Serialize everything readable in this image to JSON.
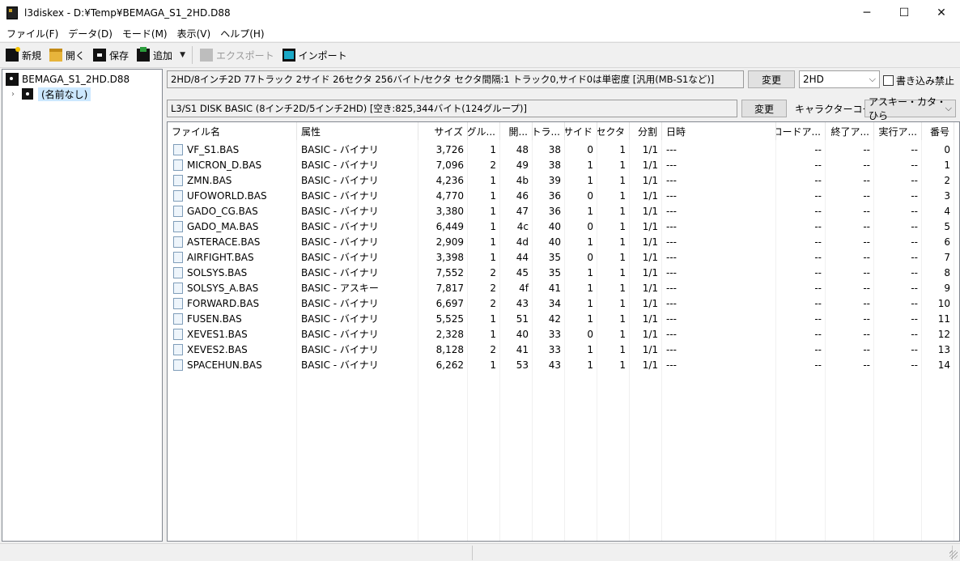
{
  "window": {
    "title": "l3diskex - D:¥Temp¥BEMAGA_S1_2HD.D88",
    "controls": {
      "minimize": "─",
      "maximize": "☐",
      "close": "✕"
    }
  },
  "menu": [
    "ファイル(F)",
    "データ(D)",
    "モード(M)",
    "表示(V)",
    "ヘルプ(H)"
  ],
  "toolbar": {
    "new": "新規",
    "open": "開く",
    "save": "保存",
    "add": "追加",
    "add_dropdown": "▼",
    "export": "エクスポート",
    "import": "インポート"
  },
  "tree": {
    "root": "BEMAGA_S1_2HD.D88",
    "child_expander": "›",
    "child": "(名前なし)"
  },
  "disk_info": {
    "format": "2HD/8インチ2D  77トラック 2サイド 26セクタ 256バイト/セクタ セクタ間隔:1 トラック0,サイド0は単密度 [汎用(MB-S1など)]",
    "change_button": "変更",
    "type_select": "2HD",
    "write_protect_label": "書き込み禁止",
    "basic_info": "L3/S1 DISK BASIC (8インチ2D/5インチ2HD) [空き:825,344バイト(124グループ)]",
    "basic_change_button": "変更",
    "charcode_label": "キャラクターコード",
    "charcode_select": "アスキー・カタ・ひら"
  },
  "columns": [
    "ファイル名",
    "属性",
    "サイズ",
    "グル...",
    "開...",
    "トラ...",
    "サイド",
    "セクタ",
    "分割",
    "日時",
    "ロードア...",
    "終了ア...",
    "実行ア...",
    "番号"
  ],
  "files": [
    {
      "name": "VF_S1.BAS",
      "attr": "BASIC - バイナリ",
      "size": "3,726",
      "groups": "1",
      "start": "48",
      "track": "38",
      "side": "0",
      "sector": "1",
      "split": "1/1",
      "date": "---",
      "load": "--",
      "end": "--",
      "exec": "--",
      "num": "0"
    },
    {
      "name": "MICRON_D.BAS",
      "attr": "BASIC - バイナリ",
      "size": "7,096",
      "groups": "2",
      "start": "49",
      "track": "38",
      "side": "1",
      "sector": "1",
      "split": "1/1",
      "date": "---",
      "load": "--",
      "end": "--",
      "exec": "--",
      "num": "1"
    },
    {
      "name": "ZMN.BAS",
      "attr": "BASIC - バイナリ",
      "size": "4,236",
      "groups": "1",
      "start": "4b",
      "track": "39",
      "side": "1",
      "sector": "1",
      "split": "1/1",
      "date": "---",
      "load": "--",
      "end": "--",
      "exec": "--",
      "num": "2"
    },
    {
      "name": "UFOWORLD.BAS",
      "attr": "BASIC - バイナリ",
      "size": "4,770",
      "groups": "1",
      "start": "46",
      "track": "36",
      "side": "0",
      "sector": "1",
      "split": "1/1",
      "date": "---",
      "load": "--",
      "end": "--",
      "exec": "--",
      "num": "3"
    },
    {
      "name": "GADO_CG.BAS",
      "attr": "BASIC - バイナリ",
      "size": "3,380",
      "groups": "1",
      "start": "47",
      "track": "36",
      "side": "1",
      "sector": "1",
      "split": "1/1",
      "date": "---",
      "load": "--",
      "end": "--",
      "exec": "--",
      "num": "4"
    },
    {
      "name": "GADO_MA.BAS",
      "attr": "BASIC - バイナリ",
      "size": "6,449",
      "groups": "1",
      "start": "4c",
      "track": "40",
      "side": "0",
      "sector": "1",
      "split": "1/1",
      "date": "---",
      "load": "--",
      "end": "--",
      "exec": "--",
      "num": "5"
    },
    {
      "name": "ASTERACE.BAS",
      "attr": "BASIC - バイナリ",
      "size": "2,909",
      "groups": "1",
      "start": "4d",
      "track": "40",
      "side": "1",
      "sector": "1",
      "split": "1/1",
      "date": "---",
      "load": "--",
      "end": "--",
      "exec": "--",
      "num": "6"
    },
    {
      "name": "AIRFIGHT.BAS",
      "attr": "BASIC - バイナリ",
      "size": "3,398",
      "groups": "1",
      "start": "44",
      "track": "35",
      "side": "0",
      "sector": "1",
      "split": "1/1",
      "date": "---",
      "load": "--",
      "end": "--",
      "exec": "--",
      "num": "7"
    },
    {
      "name": "SOLSYS.BAS",
      "attr": "BASIC - バイナリ",
      "size": "7,552",
      "groups": "2",
      "start": "45",
      "track": "35",
      "side": "1",
      "sector": "1",
      "split": "1/1",
      "date": "---",
      "load": "--",
      "end": "--",
      "exec": "--",
      "num": "8"
    },
    {
      "name": "SOLSYS_A.BAS",
      "attr": "BASIC - アスキー",
      "size": "7,817",
      "groups": "2",
      "start": "4f",
      "track": "41",
      "side": "1",
      "sector": "1",
      "split": "1/1",
      "date": "---",
      "load": "--",
      "end": "--",
      "exec": "--",
      "num": "9"
    },
    {
      "name": "FORWARD.BAS",
      "attr": "BASIC - バイナリ",
      "size": "6,697",
      "groups": "2",
      "start": "43",
      "track": "34",
      "side": "1",
      "sector": "1",
      "split": "1/1",
      "date": "---",
      "load": "--",
      "end": "--",
      "exec": "--",
      "num": "10"
    },
    {
      "name": "FUSEN.BAS",
      "attr": "BASIC - バイナリ",
      "size": "5,525",
      "groups": "1",
      "start": "51",
      "track": "42",
      "side": "1",
      "sector": "1",
      "split": "1/1",
      "date": "---",
      "load": "--",
      "end": "--",
      "exec": "--",
      "num": "11"
    },
    {
      "name": "XEVES1.BAS",
      "attr": "BASIC - バイナリ",
      "size": "2,328",
      "groups": "1",
      "start": "40",
      "track": "33",
      "side": "0",
      "sector": "1",
      "split": "1/1",
      "date": "---",
      "load": "--",
      "end": "--",
      "exec": "--",
      "num": "12"
    },
    {
      "name": "XEVES2.BAS",
      "attr": "BASIC - バイナリ",
      "size": "8,128",
      "groups": "2",
      "start": "41",
      "track": "33",
      "side": "1",
      "sector": "1",
      "split": "1/1",
      "date": "---",
      "load": "--",
      "end": "--",
      "exec": "--",
      "num": "13"
    },
    {
      "name": "SPACEHUN.BAS",
      "attr": "BASIC - バイナリ",
      "size": "6,262",
      "groups": "1",
      "start": "53",
      "track": "43",
      "side": "1",
      "sector": "1",
      "split": "1/1",
      "date": "---",
      "load": "--",
      "end": "--",
      "exec": "--",
      "num": "14"
    }
  ],
  "colors": {
    "selection": "#cce8ff",
    "window": "#f0f0f0",
    "panel": "#ffffff",
    "disabled_text": "#9a9a9a"
  }
}
